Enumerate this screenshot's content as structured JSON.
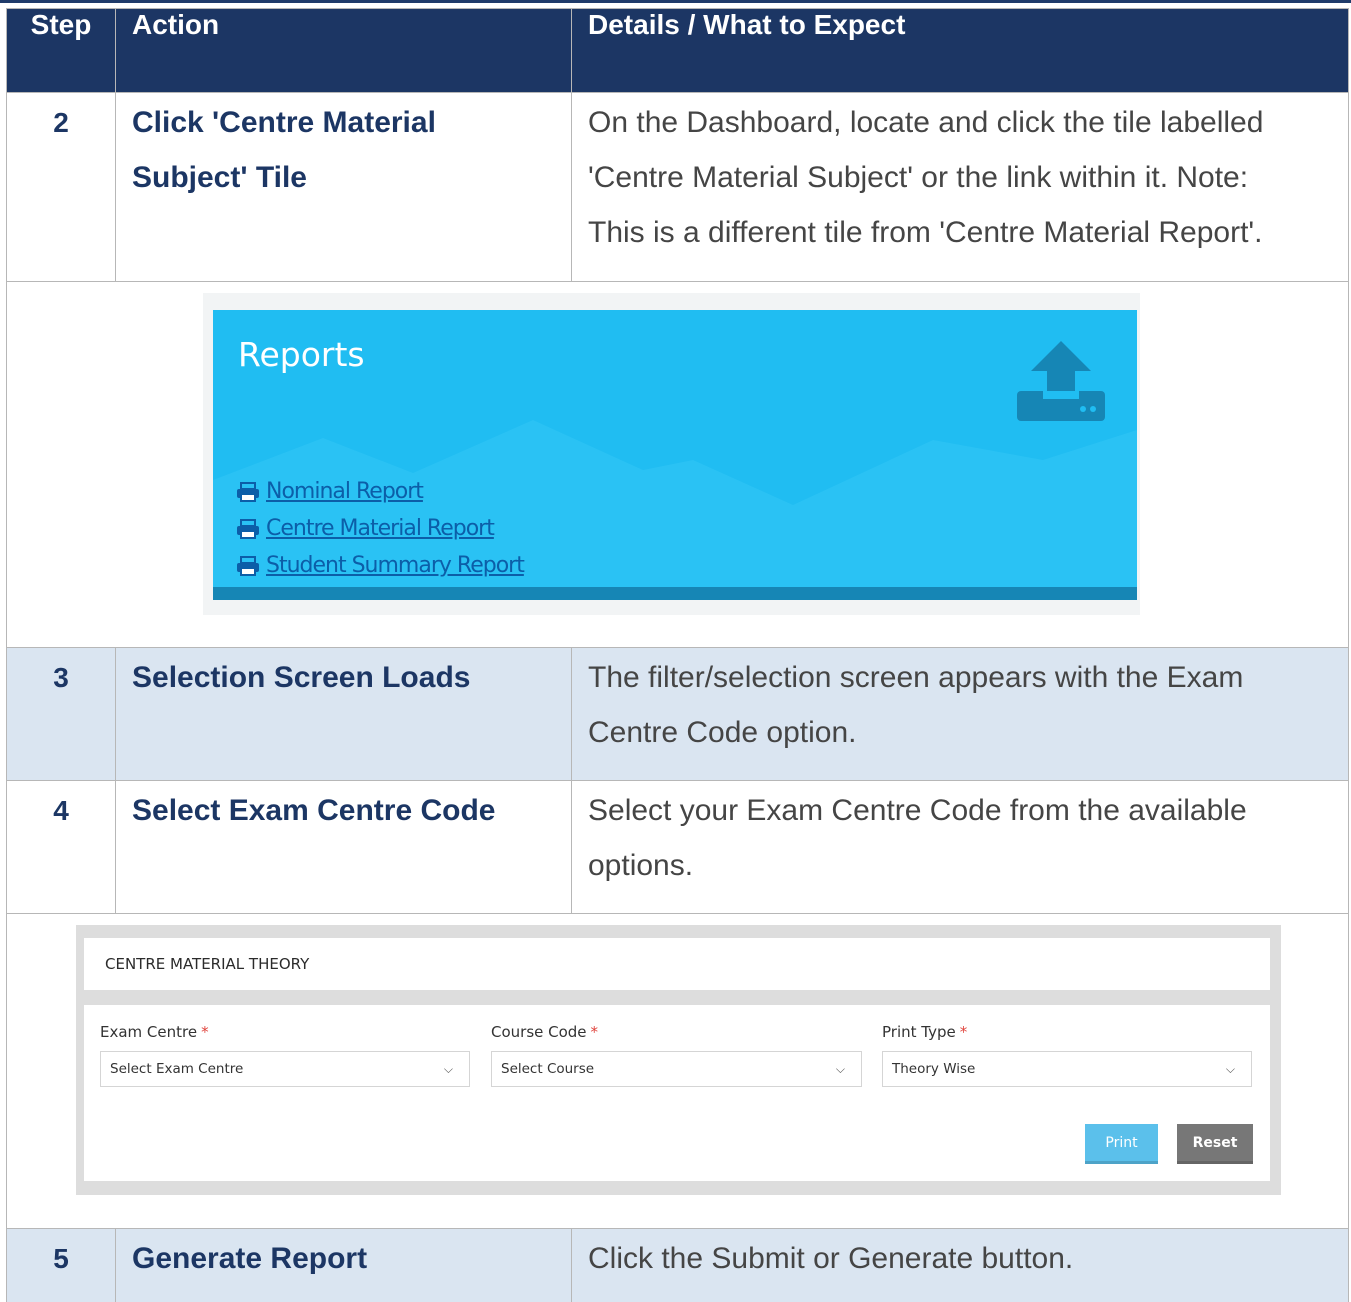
{
  "table": {
    "headers": [
      "Step",
      "Action",
      "Details / What to Expect"
    ],
    "rows": [
      {
        "step": "2",
        "action_lines": [
          "Click 'Centre Material",
          "Subject' Tile"
        ],
        "details_lines": [
          "On the Dashboard, locate and click the tile labelled",
          "'Centre Material Subject' or the link within it. Note:",
          "This is a different tile from 'Centre Material Report'."
        ]
      },
      {
        "step": "3",
        "action_lines": [
          "Selection Screen Loads"
        ],
        "details_lines": [
          "The filter/selection screen appears with the Exam",
          "Centre Code option."
        ]
      },
      {
        "step": "4",
        "action_lines": [
          "Select Exam Centre Code"
        ],
        "details_lines": [
          "Select your Exam Centre Code from the available",
          "options."
        ]
      },
      {
        "step": "5",
        "action_lines": [
          "Generate Report"
        ],
        "details_lines": [
          "Click the Submit or Generate button."
        ]
      }
    ]
  },
  "reports_tile": {
    "title": "Reports",
    "links": [
      "Nominal Report",
      "Centre Material Report",
      "Student Summary Report"
    ],
    "colors": {
      "tile": "#20bdf2",
      "link": "#0c5ea8",
      "icon": "#1686b5"
    }
  },
  "centre_form": {
    "title": "CENTRE MATERIAL THEORY",
    "fields": [
      {
        "label": "Exam Centre",
        "required": "*",
        "value": "Select Exam Centre"
      },
      {
        "label": "Course Code",
        "required": "*",
        "value": "Select Course"
      },
      {
        "label": "Print Type",
        "required": "*",
        "value": "Theory Wise"
      }
    ],
    "print_label": "Print",
    "reset_label": "Reset"
  },
  "colors": {
    "header_bg": "#1c3664",
    "shaded_row": "#dae5f1",
    "action_text": "#1c3664"
  }
}
